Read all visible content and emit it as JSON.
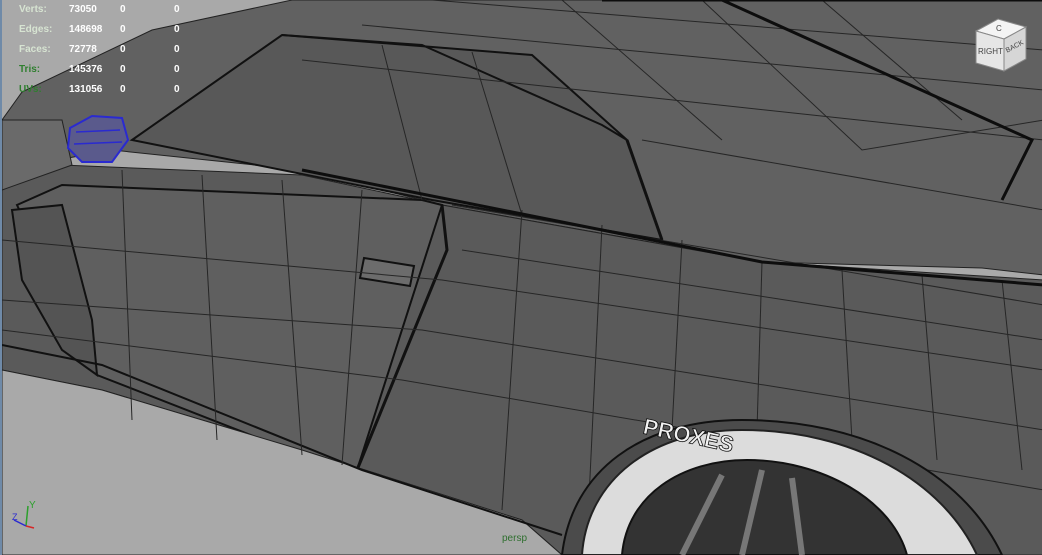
{
  "hud": {
    "rows": [
      {
        "label": "Verts:",
        "value": "73050",
        "z1": "0",
        "z2": "0",
        "dim": false
      },
      {
        "label": "Edges:",
        "value": "148698",
        "z1": "0",
        "z2": "0",
        "dim": false
      },
      {
        "label": "Faces:",
        "value": "72778",
        "z1": "0",
        "z2": "0",
        "dim": false
      },
      {
        "label": "Tris:",
        "value": "145376",
        "z1": "0",
        "z2": "0",
        "dim": true
      },
      {
        "label": "UVs:",
        "value": "131056",
        "z1": "0",
        "z2": "0",
        "dim": true
      }
    ]
  },
  "viewcube": {
    "face_right": "RIGHT",
    "face_back": "BACK",
    "top_glyph": "C"
  },
  "axis": {
    "y": "Y",
    "z": "Z"
  },
  "camera": {
    "name": "persp"
  },
  "tire_text": "PROXES",
  "colors": {
    "background": "#a9a9a9",
    "body_surface": "#5e5e5e",
    "wire": "#222222",
    "selection": "#2a2ad0",
    "hud_label": "#d7e4d2",
    "hud_label_dim": "#2f7f2f"
  }
}
